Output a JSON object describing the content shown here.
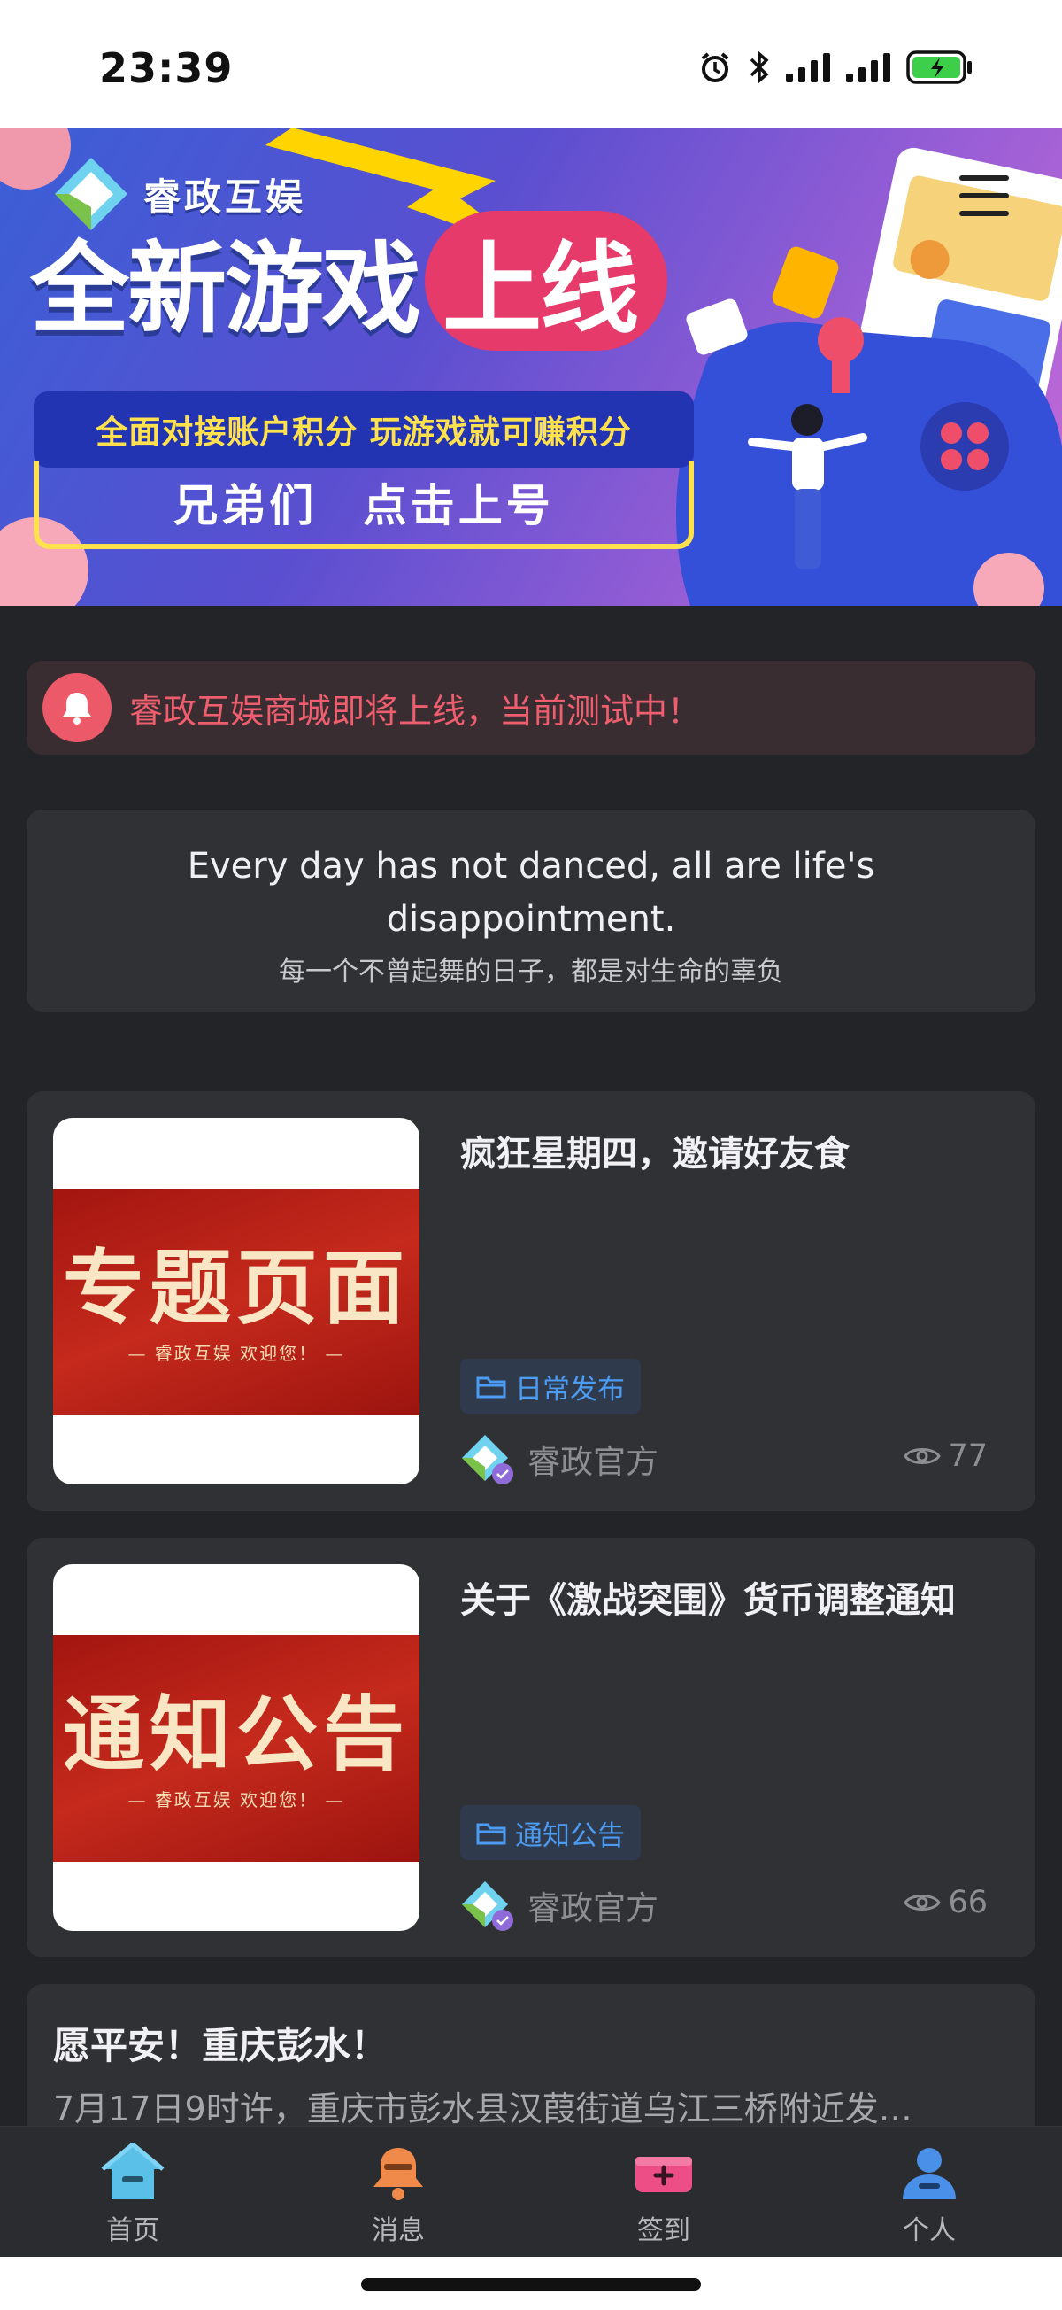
{
  "status_bar": {
    "time": "23:39"
  },
  "banner": {
    "brand_name": "睿政互娱",
    "headline_a": "全新游戏",
    "headline_b": "上线",
    "tagline": "全面对接账户积分 玩游戏就可赚积分",
    "cta": "兄弟们 点击上号"
  },
  "notice": {
    "text": "睿政互娱商城即将上线，当前测试中！",
    "icon": "bell-icon",
    "color": "#ec5a6a"
  },
  "quote": {
    "english": "Every day has not danced, all are life's disappointment.",
    "chinese": "每一个不曾起舞的日子，都是对生命的辜负"
  },
  "articles": [
    {
      "thumb_title": "专题页面",
      "thumb_sub": "— 睿政互娱 欢迎您！ —",
      "title": "疯狂星期四，邀请好友食",
      "tag": "日常发布",
      "author": "睿政官方",
      "views": "77"
    },
    {
      "thumb_title": "通知公告",
      "thumb_sub": "— 睿政互娱 欢迎您！ —",
      "title": "关于《激战突围》货币调整通知",
      "tag": "通知公告",
      "author": "睿政官方",
      "views": "66"
    }
  ],
  "text_article": {
    "title": "愿平安！重庆彭水！",
    "excerpt": "7月17日9时许，重庆市彭水县汉葭街道乌江三桥附近发…"
  },
  "tabbar": {
    "items": [
      {
        "label": "首页",
        "icon": "home-icon"
      },
      {
        "label": "消息",
        "icon": "bell-icon"
      },
      {
        "label": "签到",
        "icon": "checkin-icon"
      },
      {
        "label": "个人",
        "icon": "user-icon"
      }
    ]
  },
  "colors": {
    "accent_blue": "#4b9cf2",
    "notice_red": "#ef5e6e",
    "card_bg": "#303134",
    "page_bg": "#232427"
  }
}
